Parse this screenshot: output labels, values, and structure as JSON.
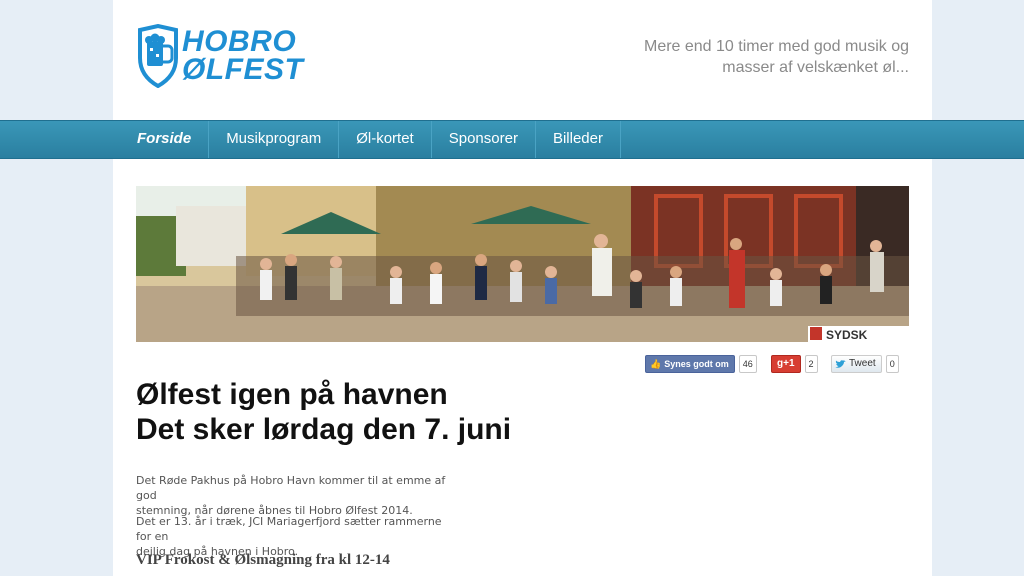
{
  "header": {
    "logo_line1": "HOBRO",
    "logo_line2": "ØLFEST",
    "tagline_line1": "Mere end 10 timer med god musik og",
    "tagline_line2": "masser af velskænket øl..."
  },
  "nav": {
    "items": [
      {
        "label": "Forside"
      },
      {
        "label": "Musikprogram"
      },
      {
        "label": "Øl-kortet"
      },
      {
        "label": "Sponsorer"
      },
      {
        "label": "Billeder"
      }
    ]
  },
  "hero": {
    "sign_text": "SYDSK"
  },
  "social": {
    "facebook_label": "Synes godt om",
    "facebook_count": "46",
    "gplus_label": "+1",
    "gplus_count": "2",
    "twitter_label": "Tweet",
    "twitter_count": "0"
  },
  "article": {
    "headline_line1": "Ølfest igen på havnen",
    "headline_line2": "Det sker lørdag den 7. juni",
    "p1_line1": "Det Røde Pakhus på Hobro Havn kommer til at emme af god",
    "p1_line2": "stemning, når dørene åbnes til Hobro Ølfest 2014.",
    "p2_line1": "Det er 13. år i træk, JCI Mariagerfjord sætter rammerne for en",
    "p2_line2": "dejlig dag på havnen i Hobro.",
    "subheading": "VIP Frokost & Ølsmagning fra kl 12-14"
  },
  "colors": {
    "brand_blue": "#1f8fd3",
    "nav_bar": "#3a97b8",
    "facebook": "#5f78ab",
    "gplus": "#d73d32"
  }
}
